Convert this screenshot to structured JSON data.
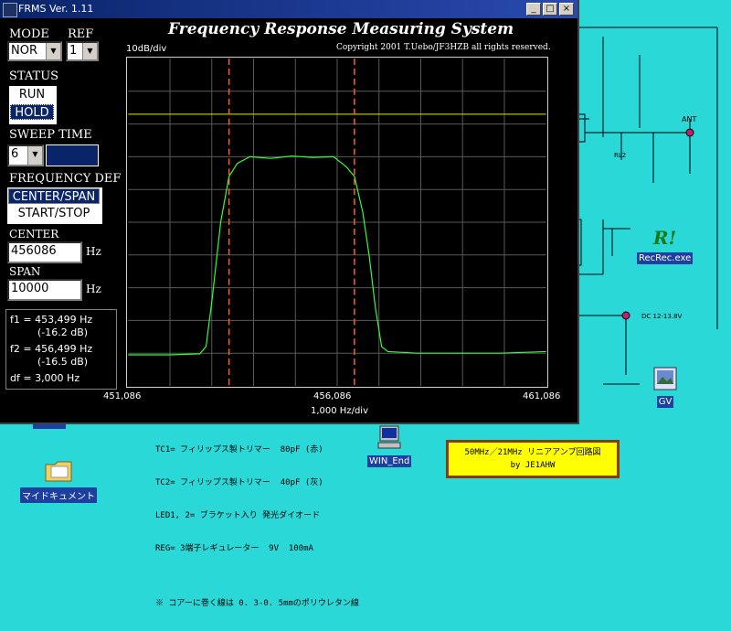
{
  "window": {
    "title": "FRMS Ver. 1.11",
    "header_title": "Frequency Response Measuring System",
    "copyright": "Copyright 2001 T.Uebo/JF3HZB all rights reserved."
  },
  "controls": {
    "mode_label": "MODE",
    "mode_value": "NOR",
    "ref_label": "REF",
    "ref_value": "1",
    "status_label": "STATUS",
    "status_options": [
      "RUN",
      "HOLD"
    ],
    "sweep_label": "SWEEP TIME",
    "sweep_value": "6",
    "freqdef_label": "FREQUENCY DEF",
    "freqdef_options": [
      "CENTER/SPAN",
      "START/STOP"
    ],
    "center_label": "CENTER",
    "center_value": "456086",
    "center_unit": "Hz",
    "span_label": "SPAN",
    "span_value": "10000",
    "span_unit": "Hz"
  },
  "info": {
    "f1": "f1 = 453,499 Hz",
    "f1_db": "(-16.2 dB)",
    "f2": "f2 = 456,499 Hz",
    "f2_db": "(-16.5 dB)",
    "df": "df = 3,000 Hz"
  },
  "chart_data": {
    "type": "line",
    "ylabel": "10dB/div",
    "xlabel": "1,000 Hz/div",
    "x_ticks": [
      "451,086",
      "456,086",
      "461,086"
    ],
    "xlim": [
      451086,
      461086
    ],
    "ylim_div": [
      0,
      10
    ],
    "reference_line_div": 8.3,
    "markers_hz": [
      453499,
      456499
    ],
    "series": [
      {
        "color": "#33ff33",
        "x": [
          451086,
          452086,
          452800,
          452950,
          453100,
          453300,
          453499,
          453700,
          454000,
          454500,
          455000,
          455500,
          456000,
          456300,
          456499,
          456700,
          456850,
          457000,
          457150,
          457300,
          458000,
          459000,
          460000,
          461086
        ],
        "y": [
          0.95,
          0.95,
          0.98,
          1.2,
          2.7,
          5.0,
          6.4,
          6.8,
          7.0,
          6.95,
          7.02,
          6.98,
          7.0,
          6.7,
          6.4,
          5.3,
          4.0,
          2.4,
          1.2,
          1.05,
          1.0,
          1.0,
          1.0,
          1.05
        ]
      }
    ]
  },
  "desktop": {
    "icons": [
      {
        "name": "RecRec.exe"
      },
      {
        "name": "GV"
      },
      {
        "name": "WIN_End"
      },
      {
        "name": "マイドキュメント"
      }
    ],
    "notes": [
      "TC1= フィリップス製トリマー  80pF (赤)",
      "TC2= フィリップス製トリマー  40pF (灰)",
      "LED1, 2= ブラケット入り 発光ダイオード",
      "REG= 3端子レギュレーター  9V  100mA",
      "",
      "※ コアーに巻く線は 0. 3-0. 5mmのポリウレタン線"
    ],
    "schematic_labels": [
      "ANT",
      "RL2",
      "DC 12-13.8V"
    ],
    "yellow_box_line1": "50MHz／21MHz リニアアンプ回路図",
    "yellow_box_line2": "by  JE1AHW"
  }
}
